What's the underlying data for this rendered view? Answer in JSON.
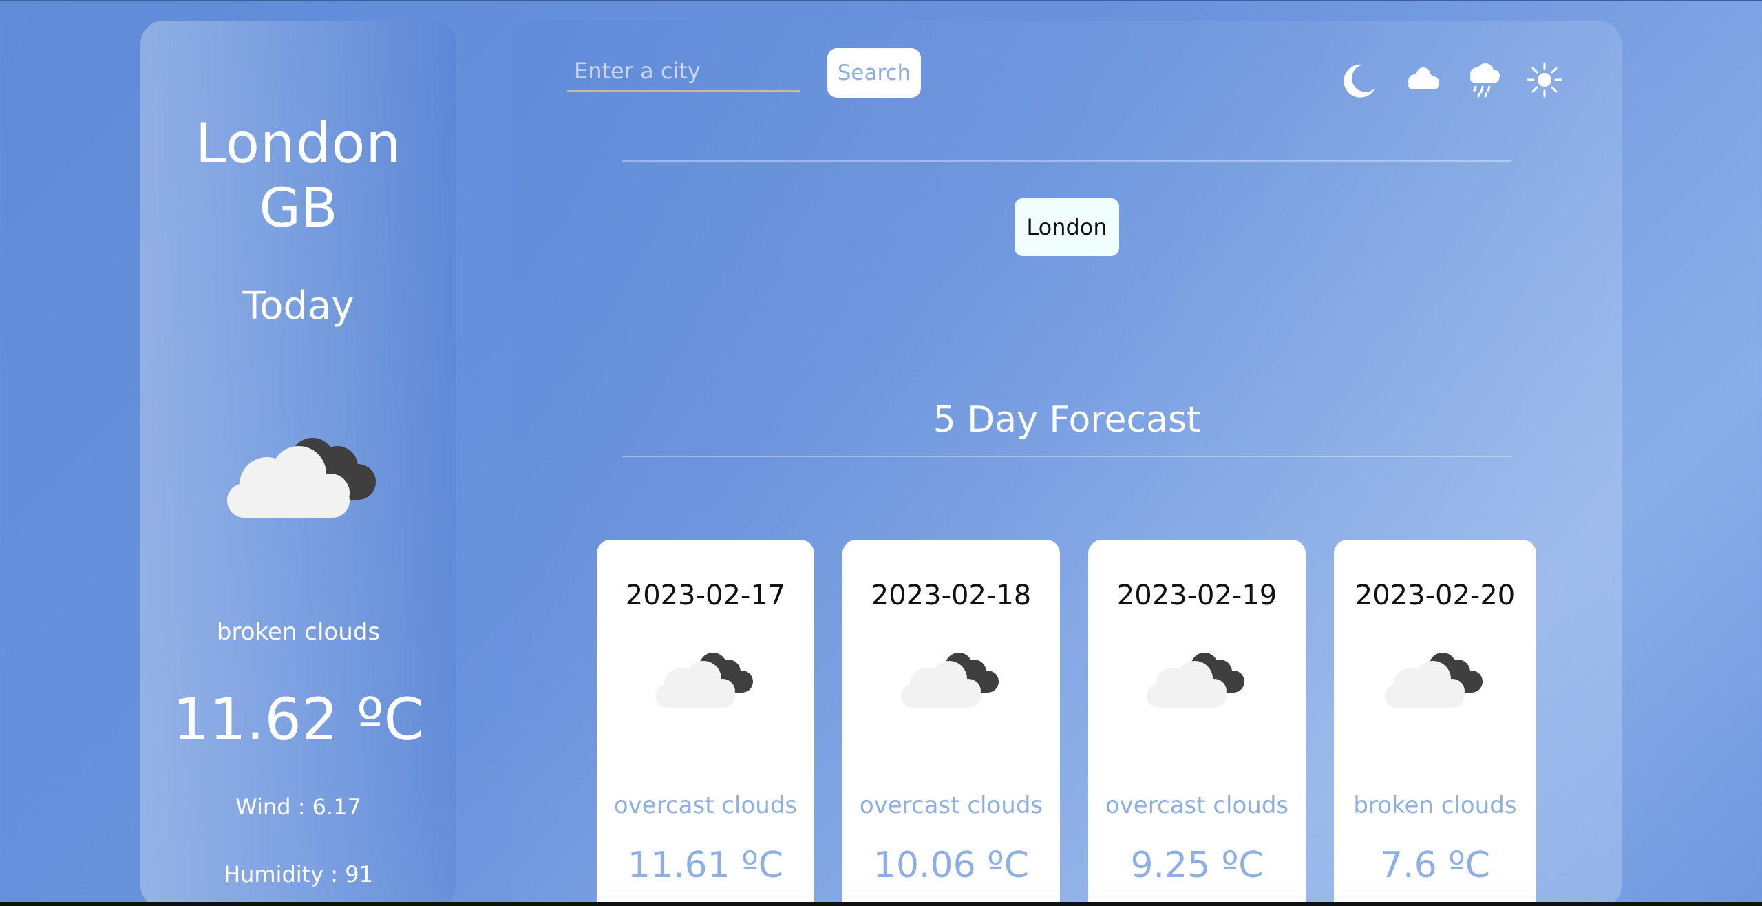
{
  "current": {
    "city": "London",
    "country": "GB",
    "day_label": "Today",
    "icon": "broken-clouds-icon",
    "description": "broken clouds",
    "temperature": "11.62 ºC",
    "wind": "Wind : 6.17",
    "humidity": "Humidity : 91"
  },
  "search": {
    "placeholder": "Enter a city",
    "button_label": "Search"
  },
  "theme_icons": [
    "moon-icon",
    "cloud-icon",
    "rain-icon",
    "sun-icon"
  ],
  "history": [
    {
      "label": "London"
    }
  ],
  "forecast": {
    "title": "5 Day Forecast",
    "days": [
      {
        "date": "2023-02-17",
        "icon": "broken-clouds-icon",
        "description": "overcast clouds",
        "temperature": "11.61 ºC"
      },
      {
        "date": "2023-02-18",
        "icon": "broken-clouds-icon",
        "description": "overcast clouds",
        "temperature": "10.06 ºC"
      },
      {
        "date": "2023-02-19",
        "icon": "broken-clouds-icon",
        "description": "overcast clouds",
        "temperature": "9.25 ºC"
      },
      {
        "date": "2023-02-20",
        "icon": "broken-clouds-icon",
        "description": "broken clouds",
        "temperature": "7.6 ºC"
      }
    ]
  },
  "colors": {
    "background": "#6a93dd",
    "card_text_accent": "#8eaee6",
    "history_chip": "#f0fffd",
    "input_underline": "#c9b8a4"
  }
}
